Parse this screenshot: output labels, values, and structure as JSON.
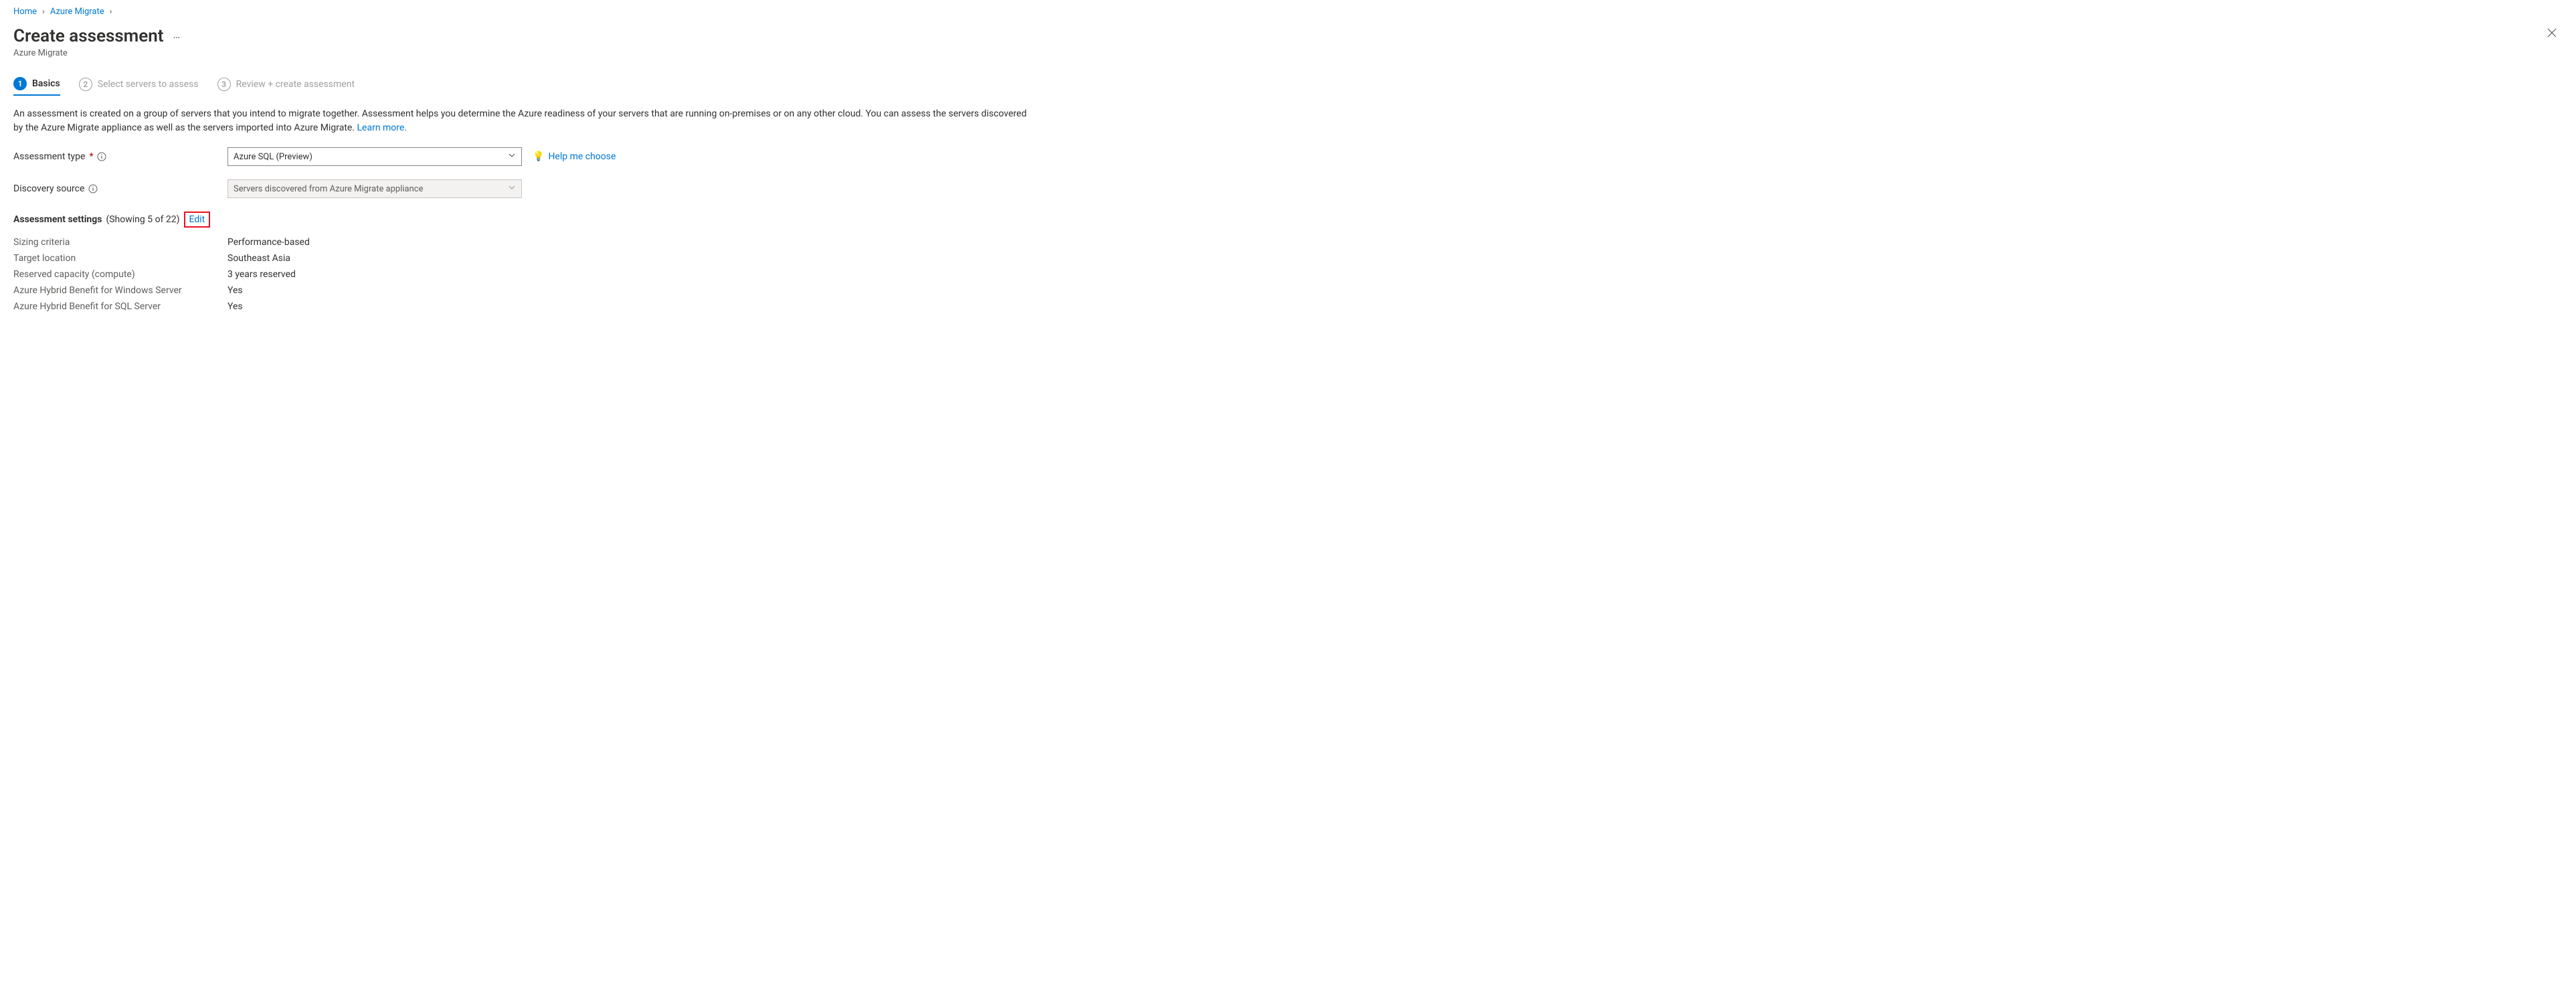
{
  "breadcrumb": {
    "home": "Home",
    "azure_migrate": "Azure Migrate"
  },
  "title": "Create assessment",
  "subtitle": "Azure Migrate",
  "tabs": {
    "basics": {
      "num": "1",
      "label": "Basics"
    },
    "select": {
      "num": "2",
      "label": "Select servers to assess"
    },
    "review": {
      "num": "3",
      "label": "Review + create assessment"
    }
  },
  "intro": {
    "text": "An assessment is created on a group of servers that you intend to migrate together. Assessment helps you determine the Azure readiness of your servers that are running on-premises or on any other cloud. You can assess the servers discovered by the Azure Migrate appliance as well as the servers imported into Azure Migrate. ",
    "learn_more": "Learn more."
  },
  "form": {
    "assessment_type": {
      "label": "Assessment type",
      "value": "Azure SQL (Preview)",
      "help_me_choose": "Help me choose"
    },
    "discovery_source": {
      "label": "Discovery source",
      "value": "Servers discovered from Azure Migrate appliance"
    }
  },
  "settings": {
    "heading": "Assessment settings",
    "showing": "(Showing 5 of 22)",
    "edit": "Edit",
    "items": [
      {
        "k": "Sizing criteria",
        "v": "Performance-based"
      },
      {
        "k": "Target location",
        "v": "Southeast Asia"
      },
      {
        "k": "Reserved capacity (compute)",
        "v": "3 years reserved"
      },
      {
        "k": "Azure Hybrid Benefit for Windows Server",
        "v": "Yes"
      },
      {
        "k": "Azure Hybrid Benefit for SQL Server",
        "v": "Yes"
      }
    ]
  }
}
